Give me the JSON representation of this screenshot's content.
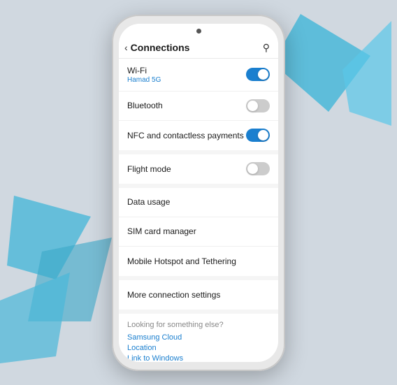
{
  "background": {
    "color": "#c8d4dc"
  },
  "header": {
    "back_label": "‹",
    "title": "Connections",
    "search_icon": "⌕"
  },
  "settings": {
    "groups": [
      {
        "id": "group1",
        "items": [
          {
            "id": "wifi",
            "label": "Wi-Fi",
            "sublabel": "Hamad 5G",
            "has_toggle": true,
            "toggle_on": true
          },
          {
            "id": "bluetooth",
            "label": "Bluetooth",
            "sublabel": null,
            "has_toggle": true,
            "toggle_on": false
          },
          {
            "id": "nfc",
            "label": "NFC and contactless payments",
            "sublabel": null,
            "has_toggle": true,
            "toggle_on": true
          }
        ]
      },
      {
        "id": "group2",
        "items": [
          {
            "id": "flight",
            "label": "Flight mode",
            "sublabel": null,
            "has_toggle": true,
            "toggle_on": false
          }
        ]
      },
      {
        "id": "group3",
        "items": [
          {
            "id": "data-usage",
            "label": "Data usage",
            "sublabel": null,
            "has_toggle": false
          },
          {
            "id": "sim",
            "label": "SIM card manager",
            "sublabel": null,
            "has_toggle": false
          },
          {
            "id": "hotspot",
            "label": "Mobile Hotspot and Tethering",
            "sublabel": null,
            "has_toggle": false
          }
        ]
      },
      {
        "id": "group4",
        "items": [
          {
            "id": "more",
            "label": "More connection settings",
            "sublabel": null,
            "has_toggle": false
          }
        ]
      }
    ],
    "looking_section": {
      "title": "Looking for something else?",
      "links": [
        "Samsung Cloud",
        "Location",
        "Link to Windows"
      ]
    }
  }
}
